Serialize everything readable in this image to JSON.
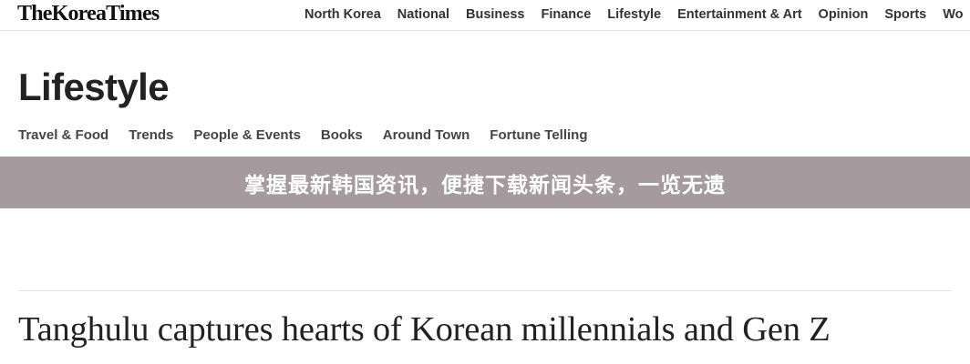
{
  "header": {
    "logo": "TheKoreaTimes",
    "nav": [
      "North Korea",
      "National",
      "Business",
      "Finance",
      "Lifestyle",
      "Entertainment & Art",
      "Opinion",
      "Sports",
      "Wo"
    ]
  },
  "section": {
    "title": "Lifestyle",
    "subnav": [
      "Travel & Food",
      "Trends",
      "People & Events",
      "Books",
      "Around Town",
      "Fortune Telling"
    ]
  },
  "banner": {
    "text": "掌握最新韩国资讯，便捷下载新闻头条，一览无遗",
    "color": "#a59a9e"
  },
  "article": {
    "headline": "Tanghulu captures hearts of Korean millennials and Gen Z"
  }
}
